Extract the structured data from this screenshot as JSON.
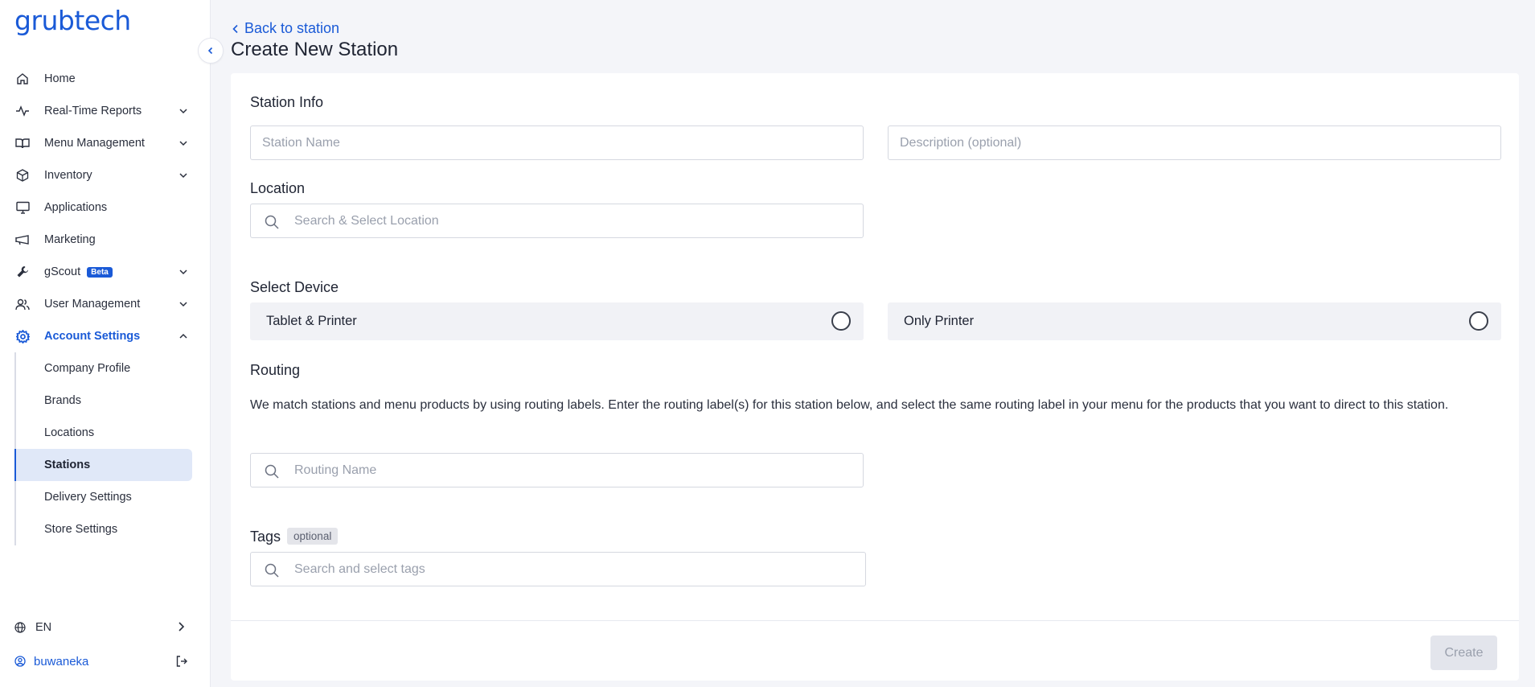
{
  "app": {
    "logo_text": "grubtech",
    "brand_color": "#1a5ad7"
  },
  "sidebar": {
    "items": [
      {
        "label": "Home",
        "icon": "home-icon",
        "expandable": false
      },
      {
        "label": "Real-Time Reports",
        "icon": "activity-icon",
        "expandable": true
      },
      {
        "label": "Menu Management",
        "icon": "book-icon",
        "expandable": true
      },
      {
        "label": "Inventory",
        "icon": "box-icon",
        "expandable": true
      },
      {
        "label": "Applications",
        "icon": "monitor-icon",
        "expandable": false
      },
      {
        "label": "Marketing",
        "icon": "megaphone-icon",
        "expandable": false
      },
      {
        "label": "gScout",
        "badge": "Beta",
        "icon": "wrench-icon",
        "expandable": true
      },
      {
        "label": "User Management",
        "icon": "users-icon",
        "expandable": true
      },
      {
        "label": "Account Settings",
        "icon": "gear-icon",
        "expandable": true,
        "active": true
      }
    ],
    "account_settings_sub": [
      {
        "label": "Company Profile"
      },
      {
        "label": "Brands"
      },
      {
        "label": "Locations"
      },
      {
        "label": "Stations",
        "selected": true
      },
      {
        "label": "Delivery Settings"
      },
      {
        "label": "Store Settings"
      }
    ],
    "language": "EN",
    "username": "buwaneka"
  },
  "header": {
    "back_label": "Back to station",
    "title": "Create New Station"
  },
  "form": {
    "station_info_title": "Station Info",
    "station_name_placeholder": "Station Name",
    "description_placeholder": "Description (optional)",
    "location_title": "Location",
    "location_placeholder": "Search & Select Location",
    "select_device_title": "Select Device",
    "device_options": [
      "Tablet & Printer",
      "Only Printer"
    ],
    "routing_title": "Routing",
    "routing_description": "We match stations and menu products by using routing labels. Enter the routing label(s) for this station below, and select the same routing label in your menu for the products that you want to direct to this station.",
    "routing_placeholder": "Routing Name",
    "tags_title": "Tags",
    "tags_optional_badge": "optional",
    "tags_placeholder": "Search and select tags",
    "create_label": "Create"
  }
}
